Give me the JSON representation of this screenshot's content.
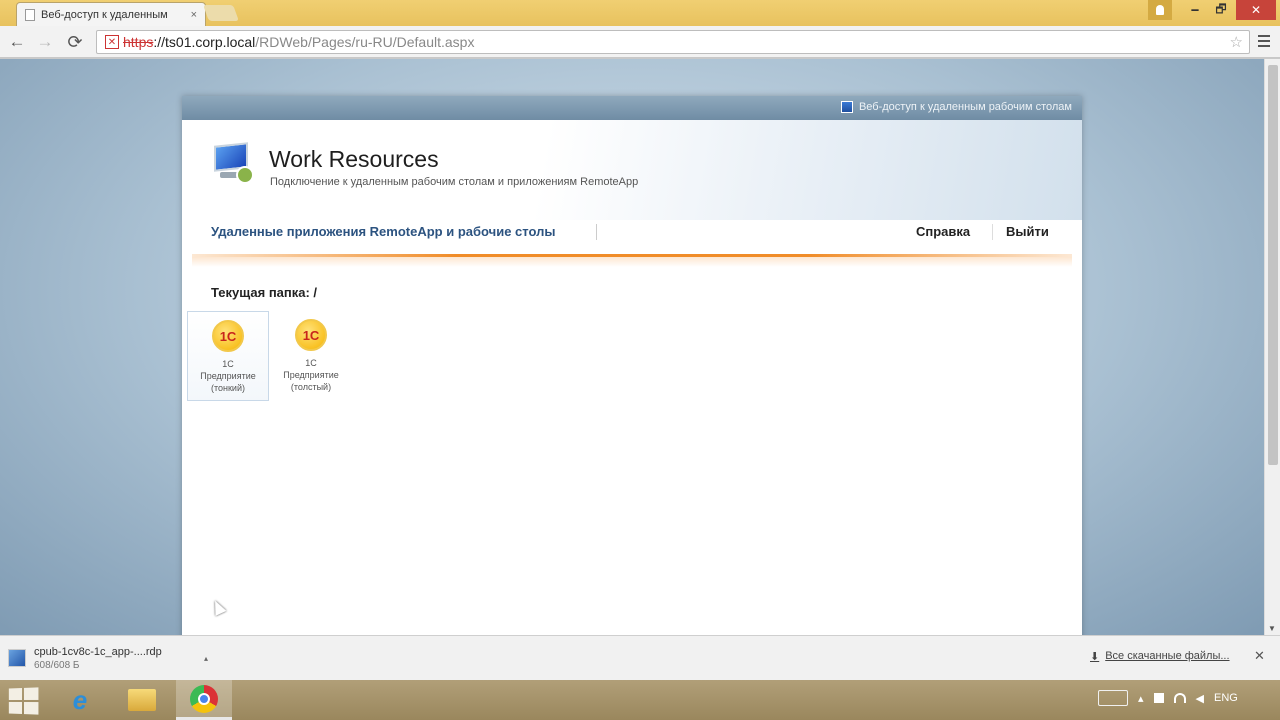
{
  "browser": {
    "tab_title": "Веб-доступ к удаленным",
    "tab_close": "×",
    "window_min": "🗕",
    "window_max": "🗗",
    "window_close": "✕",
    "url_scheme": "https",
    "url_host": "://ts01.corp.local",
    "url_path": "/RDWeb/Pages/ru-RU/Default.aspx",
    "lock_glyph": "✕",
    "star_glyph": "☆",
    "back_glyph": "←",
    "forward_glyph": "→",
    "reload_glyph": "⟳"
  },
  "rdweb": {
    "topbar_text": "Веб-доступ к удаленным рабочим столам",
    "title": "Work Resources",
    "subtitle": "Подключение к удаленным рабочим столам и приложениям RemoteApp",
    "nav_apps": "Удаленные приложения RemoteApp и рабочие столы",
    "nav_help": "Справка",
    "nav_logout": "Выйти",
    "current_folder": "Текущая папка: /",
    "apps": [
      {
        "icon_text": "1С",
        "line1": "1С",
        "line2": "Предприятие",
        "line3": "(тонкий)"
      },
      {
        "icon_text": "1С",
        "line1": "1С",
        "line2": "Предприятие",
        "line3": "(толстый)"
      }
    ]
  },
  "downloads": {
    "file_name": "cpub-1cv8c-1c_app-....rdp",
    "file_size": "608/608 Б",
    "caret": "▴",
    "all_downloads": "Все скачанные файлы...",
    "all_downloads_icon": "⬇",
    "close": "✕"
  },
  "taskbar": {
    "tray_up": "▴",
    "tray_lang": "ENG",
    "tray_speaker": "◀"
  },
  "icons": {
    "app_icon": "1c-icon",
    "ie_icon": "internet-explorer-icon",
    "chrome_icon": "chrome-icon",
    "explorer_icon": "file-explorer-icon"
  },
  "colors": {
    "accent_orange": "#f08c28",
    "nav_link_blue": "#2c5380",
    "titlebar": "#e8c25e",
    "close_button": "#c7443a"
  }
}
